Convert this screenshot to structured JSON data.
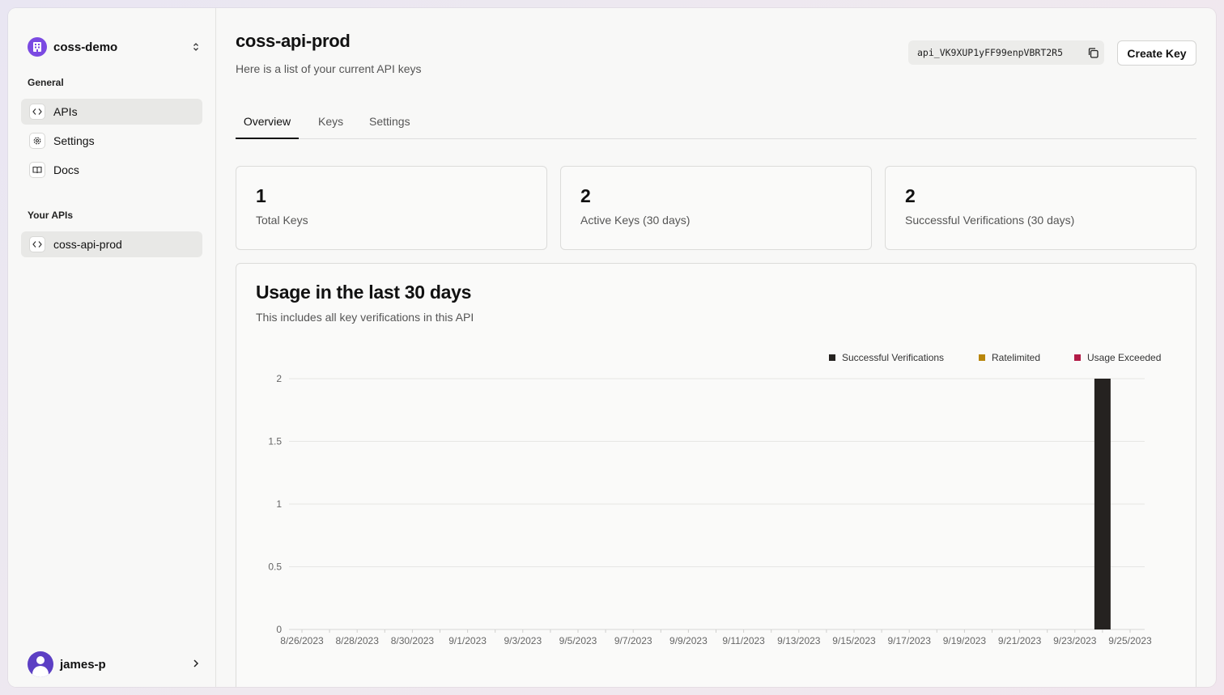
{
  "sidebar": {
    "workspace": "coss-demo",
    "general_label": "General",
    "nav": [
      {
        "label": "APIs",
        "icon": "code-icon"
      },
      {
        "label": "Settings",
        "icon": "gear-icon"
      },
      {
        "label": "Docs",
        "icon": "book-icon"
      }
    ],
    "your_apis_label": "Your APIs",
    "apis": [
      {
        "label": "coss-api-prod",
        "icon": "code-icon"
      }
    ],
    "user": "james-p"
  },
  "header": {
    "title": "coss-api-prod",
    "subtitle": "Here is a list of your current API keys",
    "api_id": "api_VK9XUP1yFF99enpVBRT2R5",
    "create_label": "Create Key"
  },
  "tabs": [
    "Overview",
    "Keys",
    "Settings"
  ],
  "stats": [
    {
      "value": "1",
      "label": "Total Keys"
    },
    {
      "value": "2",
      "label": "Active Keys (30 days)"
    },
    {
      "value": "2",
      "label": "Successful Verifications (30 days)"
    }
  ],
  "usage": {
    "title": "Usage in the last 30 days",
    "subtitle": "This includes all key verifications in this API"
  },
  "colors": {
    "accent": "#7b4ae2",
    "success_series": "#252220",
    "ratelimited_series": "#b8860b",
    "exceeded_series": "#b21c47"
  },
  "chart_data": {
    "type": "bar",
    "title": "",
    "xlabel": "",
    "ylabel": "",
    "ylim": [
      0,
      2
    ],
    "yticks": [
      "0",
      "0.5",
      "1",
      "1.5",
      "2"
    ],
    "grid": true,
    "legend_placement": "top-right",
    "categories": [
      "8/26/2023",
      "8/27/2023",
      "8/28/2023",
      "8/29/2023",
      "8/30/2023",
      "8/31/2023",
      "9/1/2023",
      "9/2/2023",
      "9/3/2023",
      "9/4/2023",
      "9/5/2023",
      "9/6/2023",
      "9/7/2023",
      "9/8/2023",
      "9/9/2023",
      "9/10/2023",
      "9/11/2023",
      "9/12/2023",
      "9/13/2023",
      "9/14/2023",
      "9/15/2023",
      "9/16/2023",
      "9/17/2023",
      "9/18/2023",
      "9/19/2023",
      "9/20/2023",
      "9/21/2023",
      "9/22/2023",
      "9/23/2023",
      "9/24/2023",
      "9/25/2023"
    ],
    "tick_labels": [
      "8/26/2023",
      "8/28/2023",
      "8/30/2023",
      "9/1/2023",
      "9/3/2023",
      "9/5/2023",
      "9/7/2023",
      "9/9/2023",
      "9/11/2023",
      "9/13/2023",
      "9/15/2023",
      "9/17/2023",
      "9/19/2023",
      "9/21/2023",
      "9/23/2023",
      "9/25/2023"
    ],
    "series": [
      {
        "name": "Successful Verifications",
        "color": "#252220",
        "values": [
          0,
          0,
          0,
          0,
          0,
          0,
          0,
          0,
          0,
          0,
          0,
          0,
          0,
          0,
          0,
          0,
          0,
          0,
          0,
          0,
          0,
          0,
          0,
          0,
          0,
          0,
          0,
          0,
          0,
          2,
          0
        ]
      },
      {
        "name": "Ratelimited",
        "color": "#b8860b",
        "values": [
          0,
          0,
          0,
          0,
          0,
          0,
          0,
          0,
          0,
          0,
          0,
          0,
          0,
          0,
          0,
          0,
          0,
          0,
          0,
          0,
          0,
          0,
          0,
          0,
          0,
          0,
          0,
          0,
          0,
          0,
          0
        ]
      },
      {
        "name": "Usage Exceeded",
        "color": "#b21c47",
        "values": [
          0,
          0,
          0,
          0,
          0,
          0,
          0,
          0,
          0,
          0,
          0,
          0,
          0,
          0,
          0,
          0,
          0,
          0,
          0,
          0,
          0,
          0,
          0,
          0,
          0,
          0,
          0,
          0,
          0,
          0,
          0
        ]
      }
    ]
  }
}
